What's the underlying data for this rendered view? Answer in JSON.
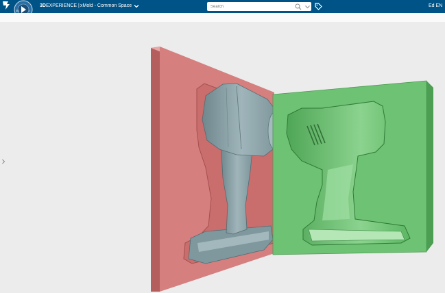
{
  "header": {
    "brand_bold": "3D",
    "brand_light": "EXPERIENCE",
    "brand_sep": "|",
    "app_name": "xMold - Common Space",
    "search_placeholder": "Search",
    "user": "Ed EN",
    "compass_version": "V.R"
  },
  "viewport": {
    "left_mold_color": "#d37b7b",
    "right_mold_color": "#6ec274",
    "part_color": "#8aa3a8"
  }
}
